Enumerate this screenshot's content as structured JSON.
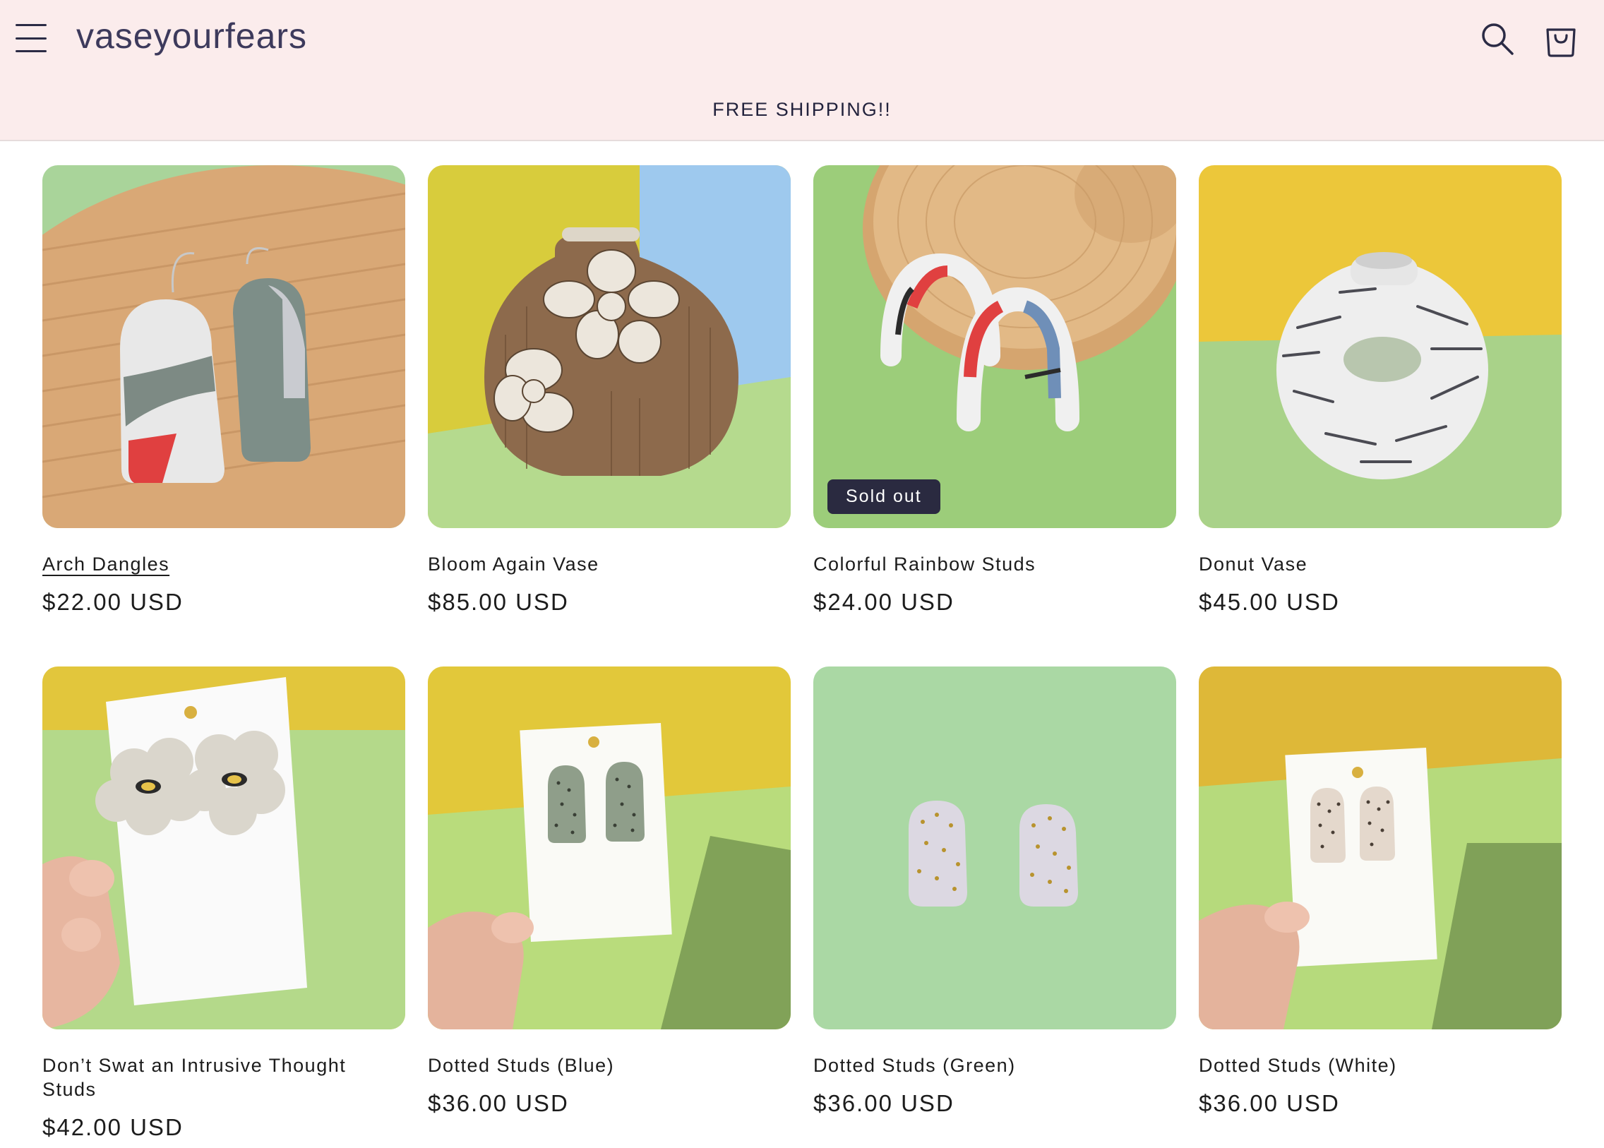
{
  "header": {
    "logo": "vaseyourfears",
    "announcement": "FREE SHIPPING!!"
  },
  "products": [
    {
      "title": "Arch Dangles",
      "price": "$22.00 USD"
    },
    {
      "title": "Bloom Again Vase",
      "price": "$85.00 USD"
    },
    {
      "title": "Colorful Rainbow Studs",
      "price": "$24.00 USD",
      "badge": "Sold out"
    },
    {
      "title": "Donut Vase",
      "price": "$45.00 USD"
    },
    {
      "title": "Don’t Swat an Intrusive Thought Studs",
      "price": "$42.00 USD"
    },
    {
      "title": "Dotted Studs (Blue)",
      "price": "$36.00 USD"
    },
    {
      "title": "Dotted Studs (Green)",
      "price": "$36.00 USD"
    },
    {
      "title": "Dotted Studs (White)",
      "price": "$36.00 USD"
    }
  ],
  "colors": {
    "header_bg": "#fbecec",
    "logo": "#3d3a5c",
    "badge_bg": "#2a2a40"
  },
  "icons": [
    "hamburger-menu-icon",
    "search-icon",
    "cart-icon"
  ]
}
